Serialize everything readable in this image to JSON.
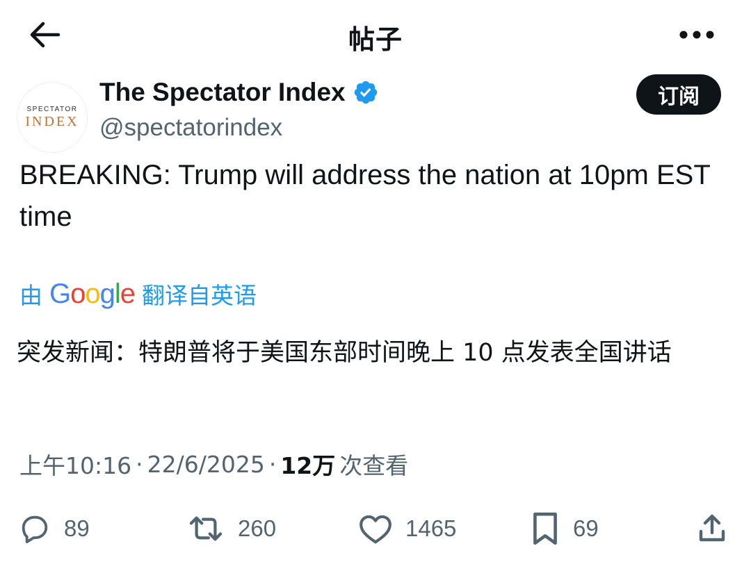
{
  "header": {
    "title": "帖子",
    "back_icon": "arrow-left-icon",
    "more_icon": "more-horizontal-icon"
  },
  "author": {
    "name": "The Spectator Index",
    "handle": "@spectatorindex",
    "verified": true,
    "avatar_text_top": "SPECTATOR",
    "avatar_text_bottom": "INDEX",
    "follow_label": "订阅"
  },
  "tweet": {
    "text": "BREAKING: Trump will address the nation at 10pm EST time"
  },
  "translation": {
    "prefix": "由",
    "provider": "Google",
    "suffix": "翻译自英语",
    "text": "突发新闻：特朗普将于美国东部时间晚上 10 点发表全国讲话"
  },
  "meta": {
    "time": "上午10:16",
    "separator": "·",
    "date": "22/6/2025",
    "views_count": "12万",
    "views_label": "次查看"
  },
  "actions": {
    "replies": "89",
    "reposts": "260",
    "likes": "1465",
    "bookmarks": "69"
  },
  "colors": {
    "text": "#0f1419",
    "secondary": "#536471",
    "link": "#1d9bf0",
    "verified": "#1d9bf0",
    "follow_bg": "#0f1419"
  }
}
